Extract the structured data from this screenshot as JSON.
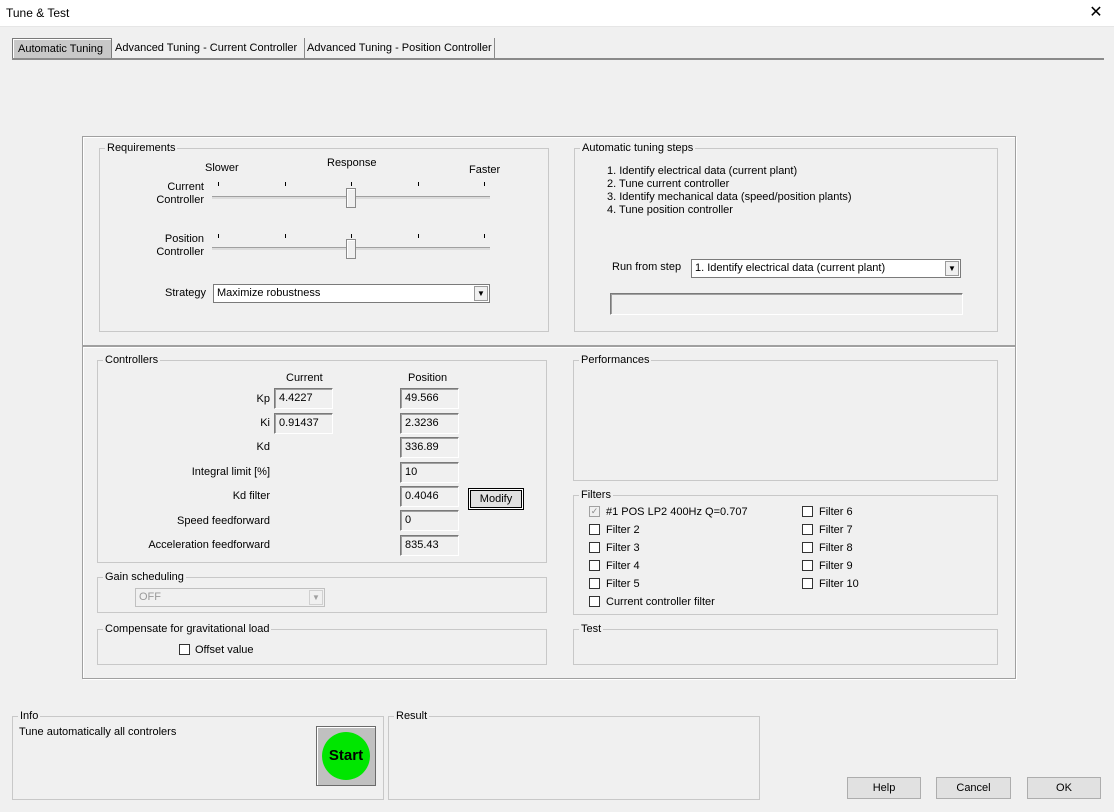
{
  "window": {
    "title": "Tune & Test",
    "close_icon": "close-icon"
  },
  "tabs": [
    {
      "label": "Automatic Tuning",
      "active": true
    },
    {
      "label": "Advanced Tuning - Current Controller",
      "active": false
    },
    {
      "label": "Advanced Tuning - Position Controller",
      "active": false
    }
  ],
  "requirements": {
    "title": "Requirements",
    "slower": "Slower",
    "response": "Response",
    "faster": "Faster",
    "current_label_1": "Current",
    "current_label_2": "Controller",
    "position_label_1": "Position",
    "position_label_2": "Controller",
    "current_slider_level": 0.5,
    "position_slider_level": 0.5,
    "strategy_label": "Strategy",
    "strategy_value": "Maximize robustness"
  },
  "auto_steps": {
    "title": "Automatic tuning steps",
    "steps": [
      "1. Identify electrical data (current plant)",
      "2. Tune current controller",
      "3. Identify mechanical data (speed/position plants)",
      "4. Tune position controller"
    ],
    "run_from_label": "Run from step",
    "run_from_value": "1. Identify electrical data (current plant)",
    "progress_text": ""
  },
  "controllers": {
    "title": "Controllers",
    "col_current": "Current",
    "col_position": "Position",
    "kp_label": "Kp",
    "kp_current": "4.4227",
    "kp_position": "49.566",
    "ki_label": "Ki",
    "ki_current": "0.91437",
    "ki_position": "2.3236",
    "kd_label": "Kd",
    "kd_position": "336.89",
    "integral_label": "Integral limit [%]",
    "integral_position": "10",
    "kdfilter_label": "Kd filter",
    "kdfilter_position": "0.4046",
    "modify_label": "Modify",
    "speedff_label": "Speed feedforward",
    "speedff_position": "0",
    "accelff_label": "Acceleration feedforward",
    "accelff_position": "835.43"
  },
  "gain_scheduling": {
    "title": "Gain scheduling",
    "value": "OFF"
  },
  "gravity": {
    "title": "Compensate for gravitational load",
    "offset_label": "Offset value",
    "offset_checked": false
  },
  "performances": {
    "title": "Performances"
  },
  "filters": {
    "title": "Filters",
    "items": [
      {
        "label": "#1 POS LP2 400Hz Q=0.707",
        "checked": true
      },
      {
        "label": "Filter 2",
        "checked": false
      },
      {
        "label": "Filter 3",
        "checked": false
      },
      {
        "label": "Filter 4",
        "checked": false
      },
      {
        "label": "Filter 5",
        "checked": false
      },
      {
        "label": "Current controller filter",
        "checked": false
      },
      {
        "label": "Filter 6",
        "checked": false
      },
      {
        "label": "Filter 7",
        "checked": false
      },
      {
        "label": "Filter 8",
        "checked": false
      },
      {
        "label": "Filter 9",
        "checked": false
      },
      {
        "label": "Filter 10",
        "checked": false
      }
    ]
  },
  "test": {
    "title": "Test"
  },
  "info": {
    "title": "Info",
    "text": "Tune automatically all controlers",
    "start_label": "Start",
    "start_color": "#00e600"
  },
  "result": {
    "title": "Result"
  },
  "buttons": {
    "help": "Help",
    "cancel": "Cancel",
    "ok": "OK"
  }
}
